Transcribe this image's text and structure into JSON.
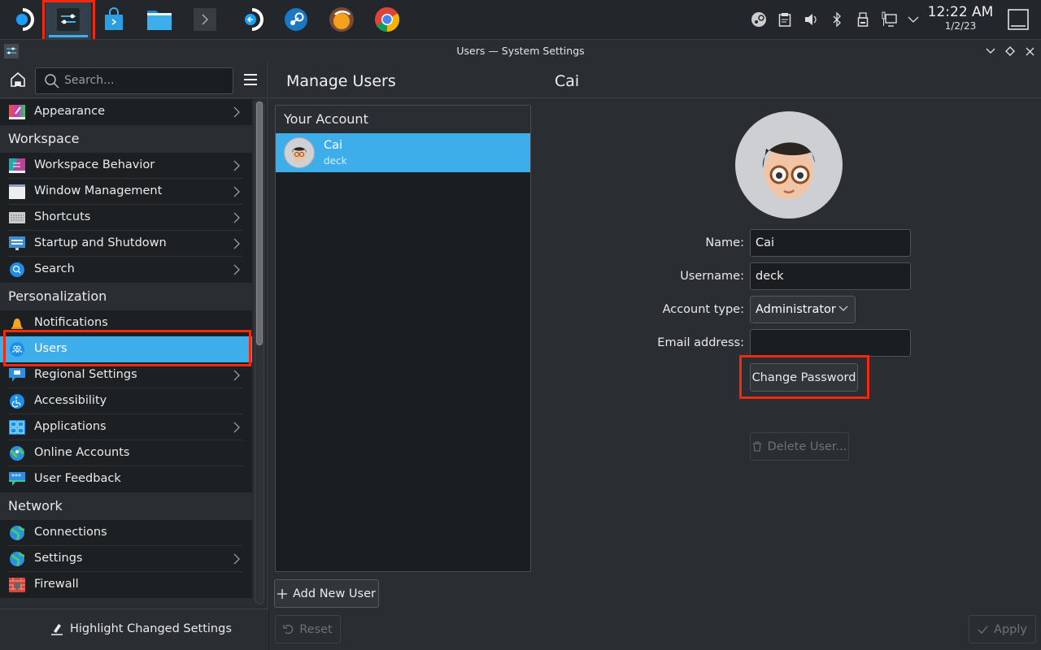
{
  "taskbar": {
    "apps": [
      {
        "name": "steam-deck-menu",
        "icon": "steamos-icon"
      },
      {
        "name": "system-settings",
        "icon": "settings-sliders-icon",
        "active": true
      },
      {
        "name": "discover",
        "icon": "store-bag-icon"
      },
      {
        "name": "dolphin",
        "icon": "folder-icon"
      },
      {
        "name": "konsole",
        "icon": "terminal-icon"
      },
      {
        "name": "return-to-gaming-mode",
        "icon": "return-icon"
      },
      {
        "name": "steam",
        "icon": "steam-icon"
      },
      {
        "name": "protonup",
        "icon": "app-icon"
      },
      {
        "name": "chrome",
        "icon": "chrome-icon"
      }
    ],
    "tray": [
      "steam-tray-icon",
      "clipboard-icon",
      "volume-icon",
      "bluetooth-icon",
      "usb-icon",
      "network-icon",
      "expand-tray-icon"
    ],
    "clock": {
      "time": "12:22 AM",
      "date": "1/2/23"
    }
  },
  "window": {
    "title": "Users — System Settings"
  },
  "sidebar": {
    "search_placeholder": "Search...",
    "top_item": {
      "label": "Appearance",
      "chevron": true
    },
    "categories": [
      {
        "label": "Workspace",
        "items": [
          {
            "label": "Workspace Behavior",
            "chevron": true
          },
          {
            "label": "Window Management",
            "chevron": true
          },
          {
            "label": "Shortcuts",
            "chevron": true
          },
          {
            "label": "Startup and Shutdown",
            "chevron": true
          },
          {
            "label": "Search",
            "chevron": true
          }
        ]
      },
      {
        "label": "Personalization",
        "items": [
          {
            "label": "Notifications",
            "chevron": false
          },
          {
            "label": "Users",
            "chevron": false,
            "selected": true
          },
          {
            "label": "Regional Settings",
            "chevron": true
          },
          {
            "label": "Accessibility",
            "chevron": false
          },
          {
            "label": "Applications",
            "chevron": true
          },
          {
            "label": "Online Accounts",
            "chevron": false
          },
          {
            "label": "User Feedback",
            "chevron": false
          }
        ]
      },
      {
        "label": "Network",
        "items": [
          {
            "label": "Connections",
            "chevron": false
          },
          {
            "label": "Settings",
            "chevron": true
          },
          {
            "label": "Firewall",
            "chevron": false
          }
        ]
      }
    ],
    "footer_button": "Highlight Changed Settings"
  },
  "main": {
    "page_title": "Manage Users",
    "user_title": "Cai",
    "list_header": "Your Account",
    "users": [
      {
        "name": "Cai",
        "username": "deck",
        "selected": true
      }
    ],
    "add_user_label": "Add New User",
    "reset_label": "Reset",
    "apply_label": "Apply",
    "form": {
      "name_label": "Name:",
      "name_value": "Cai",
      "username_label": "Username:",
      "username_value": "deck",
      "account_type_label": "Account type:",
      "account_type_value": "Administrator",
      "email_label": "Email address:",
      "email_value": "",
      "change_password_label": "Change Password",
      "delete_user_label": "Delete User..."
    }
  },
  "colors": {
    "accent": "#3daee9",
    "highlight": "#f02a0f"
  }
}
